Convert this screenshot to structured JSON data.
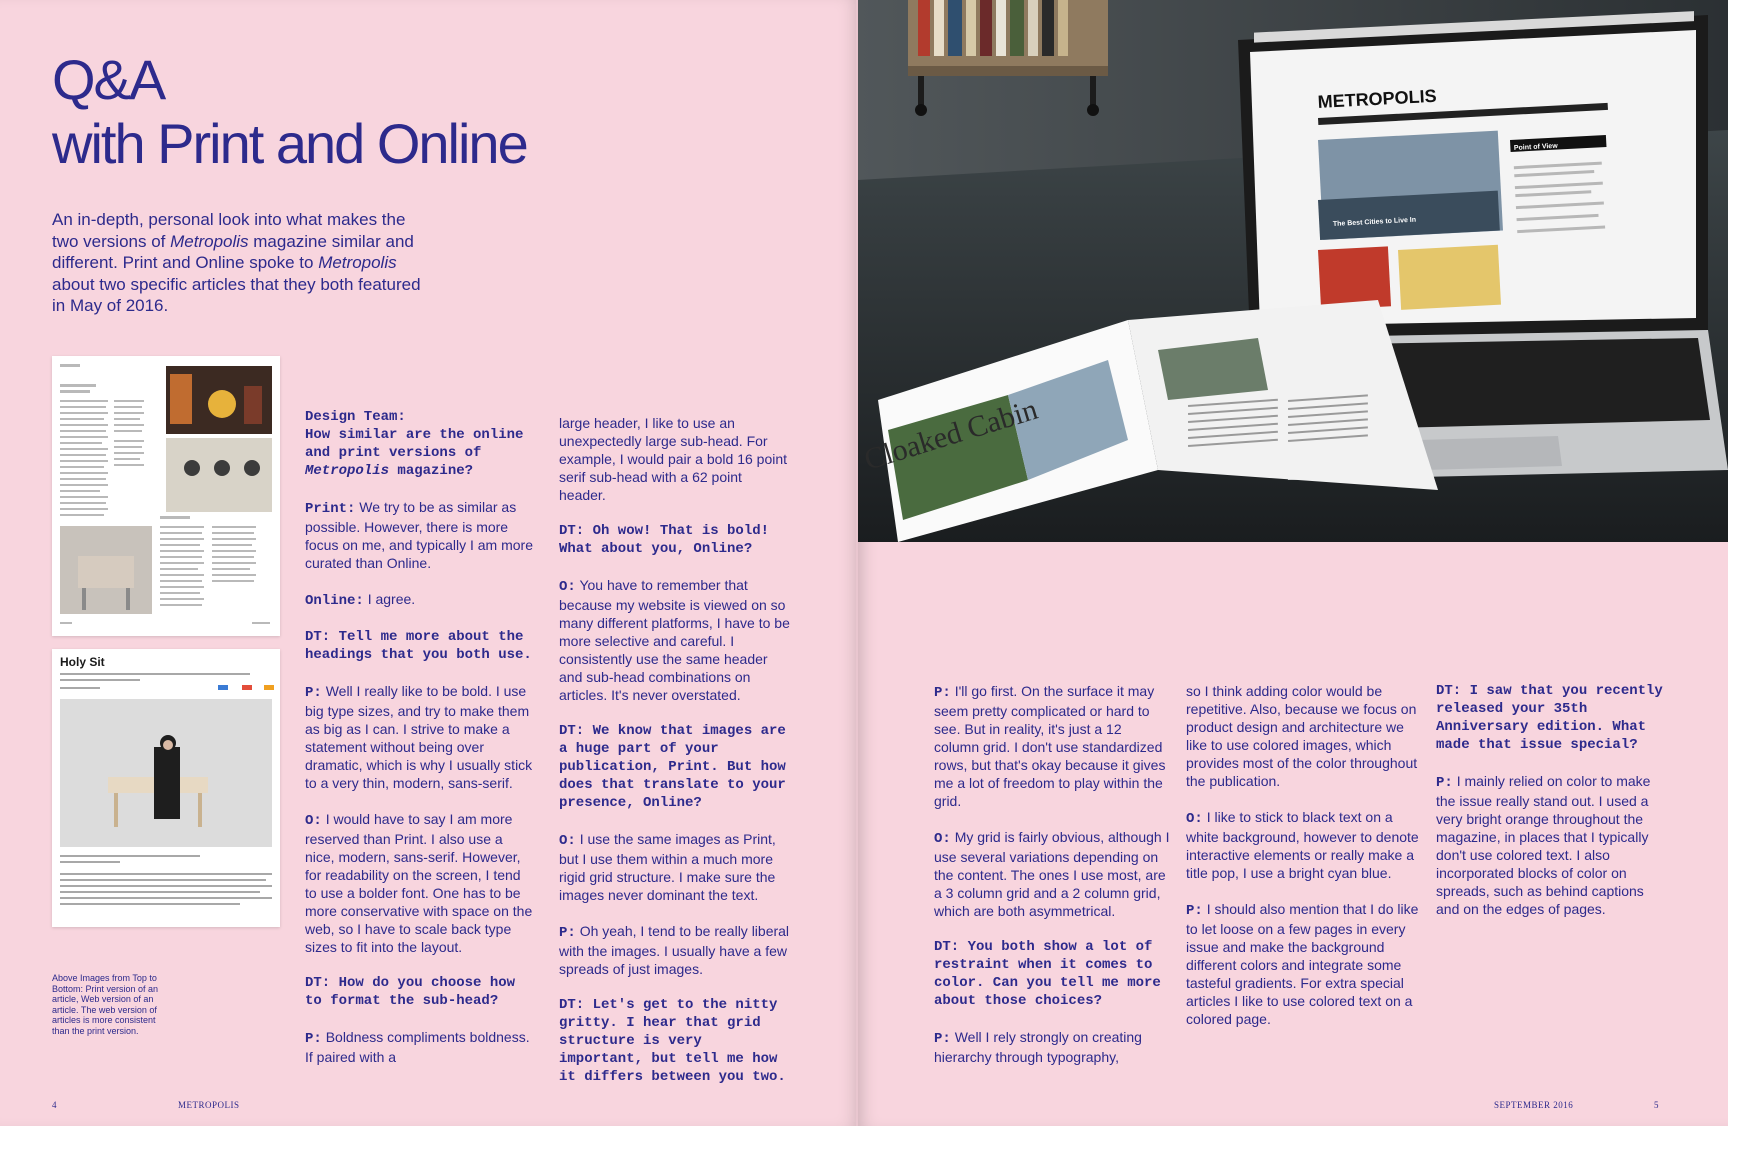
{
  "left": {
    "title_line1": "Q&A",
    "title_line2": "with Print and Online",
    "intro_a": "An in-depth, personal look into what makes the two versions of ",
    "intro_b": "Metropolis",
    "intro_c": " magazine similar and different. Print and Online spoke to ",
    "intro_d": "Metropolis",
    "intro_e": " about two specific articles that they both featured in May of 2016.",
    "thumb2_title": "Holy Sit",
    "caption": "Above Images from Top to Bottom: Print version of an article, Web version of an article. The web version of articles is more consistent than the print version.",
    "footer_page": "4",
    "footer_name": "METROPOLIS"
  },
  "col1": {
    "q1_a": "Design Team:",
    "q1_b": "How similar are the online and print versions of ",
    "q1_c": "Metropolis",
    "q1_d": " magazine?",
    "a1_s": "Print:",
    "a1_t": " We try to be as similar as possible. However, there is more focus on me, and typically I am more curated than Online.",
    "a2_s": "Online:",
    "a2_t": " I agree.",
    "q2": "DT: Tell me more about the headings that you both use.",
    "a3_s": "P:",
    "a3_t": " Well I really like to be bold. I use big type sizes, and try to make them as big as I can. I strive to make a statement without being over dramatic, which is why I usually stick to a very thin, modern, sans-serif.",
    "a4_s": "O:",
    "a4_t": " I would have to say I am more reserved than Print. I also use a nice, modern, sans-serif. However, for readability on the screen, I tend to use a bolder font. One has to be more conservative with space on the web, so I have to scale back type sizes to fit into the layout.",
    "q3": "DT: How do you choose how to format the sub-head?",
    "a5_s": "P:",
    "a5_t": " Boldness compliments boldness. If paired with a"
  },
  "col2": {
    "a1_t": "large header, I like to use an unexpectedly large sub-head. For example, I would pair a bold 16 point serif sub-head with a 62 point header.",
    "q1": "DT: Oh wow! That is bold! What about you, Online?",
    "a2_s": "O:",
    "a2_t": " You have to remember that because my website is viewed on so many different platforms, I have to be more selective and careful. I consistently use the same header and sub-head combinations on articles. It's never overstated.",
    "q2": "DT: We know that images are a huge part of your publication, Print. But how does that translate to your presence, Online?",
    "a3_s": "O:",
    "a3_t": " I use the same images as Print, but I use them within a much more rigid grid structure. I make sure the images never dominant the text.",
    "a4_s": "P:",
    "a4_t": " Oh yeah, I tend to be really liberal with the images. I usually have a few spreads of just images.",
    "q3": "DT: Let's get to the nitty gritty. I hear that grid structure is very important, but tell me how it differs between you two."
  },
  "col3": {
    "a1_s": "P:",
    "a1_t": " I'll go first. On the surface it may seem pretty complicated or hard to see. But in reality, it's just a 12 column grid. I don't use standardized rows, but that's okay because it gives me a lot of freedom to play within the grid.",
    "a2_s": "O:",
    "a2_t": " My grid is fairly obvious, although I use several variations depending on the content. The ones I use most, are a 3 column grid and a 2 column grid, which are both asymmetrical.",
    "q1": "DT: You both show a lot of restraint when it comes to color. Can you tell me more about those choices?",
    "a3_s": "P:",
    "a3_t": " Well I rely strongly on creating hierarchy through typography,"
  },
  "col4": {
    "a1_t": "so I think adding color would be repetitive. Also, because we focus on product design and architecture we like to use colored images, which provides most of the color throughout the publication.",
    "a2_s": "O:",
    "a2_t": " I like to stick to black text on a white background, however to denote interactive elements or really make a title pop, I use a bright cyan blue.",
    "a3_s": "P:",
    "a3_t": " I should also mention that I do like to let loose on a few pages in every issue and make the background different colors and integrate some tasteful gradients. For extra special articles I like to use colored text on a colored page."
  },
  "col5": {
    "q1": "DT: I saw that you recently released your 35th Anniversary edition. What made that issue special?",
    "a1_s": "P:",
    "a1_t": " I mainly relied on color to make the issue really stand out. I used a very bright orange throughout the magazine, in places that I typically don't use colored text. I also incorporated blocks of color on spreads, such as behind captions and on the edges of pages."
  },
  "photo": {
    "site_logo": "METROPOLIS",
    "magazine_heading": "Cloaked Cabin",
    "site_section": "Point of View",
    "site_banner": "The Best Cities to Live In"
  },
  "right": {
    "footer_date": "SEPTEMBER 2016",
    "footer_page": "5"
  },
  "colors": {
    "page_pink": "#f8d5de",
    "ink_indigo": "#2d2a8c"
  },
  "icons": [
    "laptop-image",
    "magazine-image",
    "bookshelf-image"
  ]
}
